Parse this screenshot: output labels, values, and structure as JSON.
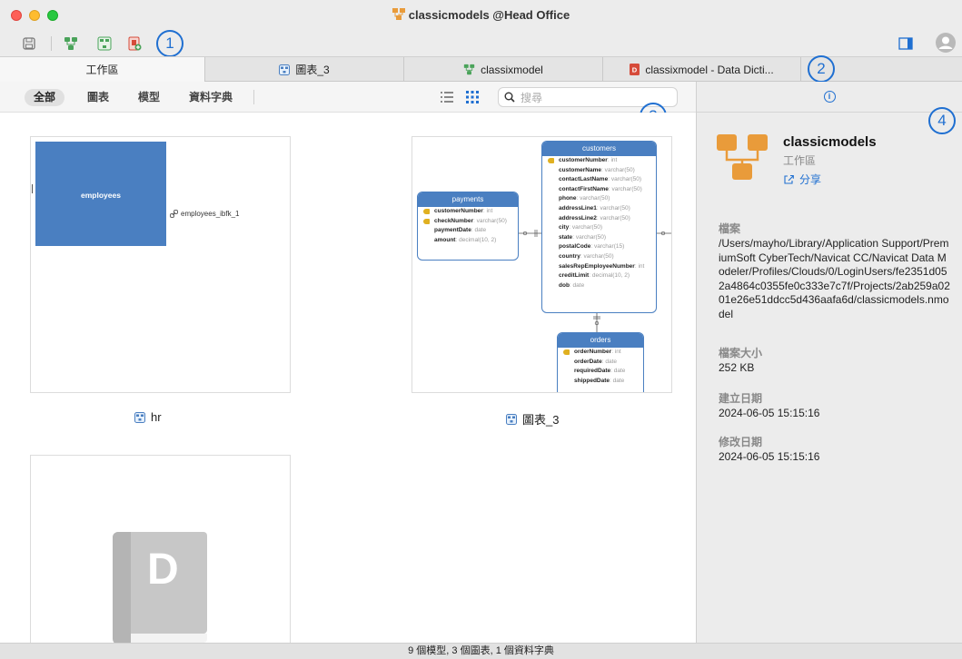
{
  "window": {
    "title": "classicmodels @Head Office"
  },
  "annotations": [
    "1",
    "2",
    "3",
    "4"
  ],
  "tabs": [
    {
      "label": "工作區"
    },
    {
      "label": "圖表_3"
    },
    {
      "label": "classixmodel"
    },
    {
      "label": "classixmodel - Data Dicti..."
    }
  ],
  "filters": [
    {
      "label": "全部"
    },
    {
      "label": "圖表"
    },
    {
      "label": "模型"
    },
    {
      "label": "資料字典"
    }
  ],
  "search": {
    "placeholder": "搜尋"
  },
  "cards": [
    {
      "label": "hr",
      "diagram": {
        "table": "employees",
        "relation": "employees_ibfk_1"
      }
    },
    {
      "label": "圖表_3",
      "diagram": {
        "customers": {
          "name": "customers",
          "rows": [
            {
              "name": "customerNumber",
              "type": "int",
              "key": true
            },
            {
              "name": "customerName",
              "type": "varchar(50)"
            },
            {
              "name": "contactLastName",
              "type": "varchar(50)"
            },
            {
              "name": "contactFirstName",
              "type": "varchar(50)"
            },
            {
              "name": "phone",
              "type": "varchar(50)"
            },
            {
              "name": "addressLine1",
              "type": "varchar(50)"
            },
            {
              "name": "addressLine2",
              "type": "varchar(50)"
            },
            {
              "name": "city",
              "type": "varchar(50)"
            },
            {
              "name": "state",
              "type": "varchar(50)"
            },
            {
              "name": "postalCode",
              "type": "varchar(15)"
            },
            {
              "name": "country",
              "type": "varchar(50)"
            },
            {
              "name": "salesRepEmployeeNumber",
              "type": "int"
            },
            {
              "name": "creditLimit",
              "type": "decimal(10, 2)"
            },
            {
              "name": "dob",
              "type": "date"
            }
          ]
        },
        "payments": {
          "name": "payments",
          "rows": [
            {
              "name": "customerNumber",
              "type": "int",
              "key": true
            },
            {
              "name": "checkNumber",
              "type": "varchar(50)",
              "key": true
            },
            {
              "name": "paymentDate",
              "type": "date"
            },
            {
              "name": "amount",
              "type": "decimal(10, 2)"
            }
          ]
        },
        "orders": {
          "name": "orders",
          "rows": [
            {
              "name": "orderNumber",
              "type": "int",
              "key": true
            },
            {
              "name": "orderDate",
              "type": "date"
            },
            {
              "name": "requiredDate",
              "type": "date"
            },
            {
              "name": "shippedDate",
              "type": "date"
            }
          ]
        }
      }
    },
    {
      "label": "",
      "icon_letter": "D"
    }
  ],
  "sidebar": {
    "name": "classicmodels",
    "subtitle": "工作區",
    "share_label": "分享",
    "file_label": "檔案",
    "file_path": "/Users/mayho/Library/Application Support/PremiumSoft CyberTech/Navicat CC/Navicat Data Modeler/Profiles/Clouds/0/LoginUsers/fe2351d052a4864c0355fe0c333e7c7f/Projects/2ab259a0201e26e51ddcc5d436aafa6d/classicmodels.nmodel",
    "size_label": "檔案大小",
    "size_value": "252 KB",
    "created_label": "建立日期",
    "created_value": "2024-06-05 15:15:16",
    "modified_label": "修改日期",
    "modified_value": "2024-06-05 15:15:16"
  },
  "status": {
    "text": "9 個模型, 3 個圖表, 1 個資料字典"
  },
  "colors": {
    "accent": "#1f6fd1",
    "er_header": "#4a7fc1",
    "model_icon": "#e99b3a"
  }
}
